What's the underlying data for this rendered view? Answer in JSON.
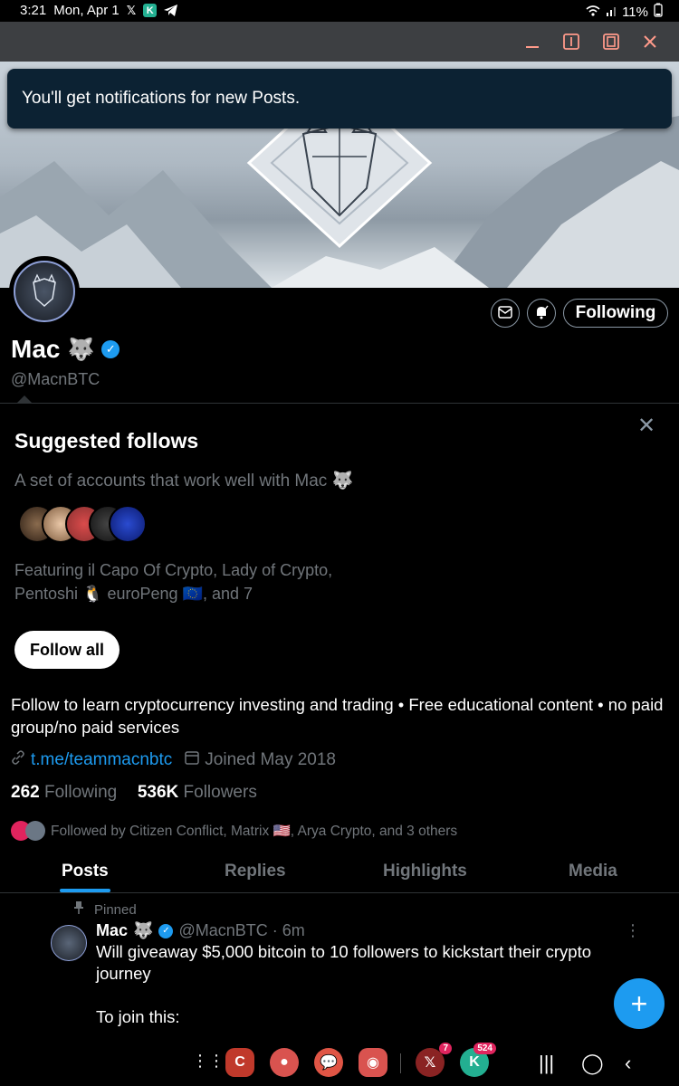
{
  "status_bar": {
    "time": "3:21",
    "date": "Mon, Apr 1",
    "battery": "11%"
  },
  "toast": {
    "text": "You'll get notifications for new Posts."
  },
  "profile": {
    "name": "Mac",
    "name_emoji": "🐺",
    "handle": "@MacnBTC",
    "following_button": "Following",
    "bio": "Follow to learn cryptocurrency investing and trading • Free educational content • no paid group/no paid services",
    "link": "t.me/teammacnbtc",
    "joined": "Joined May 2018",
    "following_count": "262",
    "following_label": "Following",
    "followers_count": "536K",
    "followers_label": "Followers",
    "followed_by": "Followed by Citizen Conflict, Matrix 🇺🇸, Arya Crypto, and 3 others"
  },
  "suggested": {
    "title": "Suggested follows",
    "subtitle": "A set of accounts that work well with Mac 🐺",
    "featuring": "Featuring il Capo Of Crypto, Lady of Crypto, Pentoshi 🐧 euroPeng 🇪🇺, and 7",
    "follow_all": "Follow all"
  },
  "tabs": [
    "Posts",
    "Replies",
    "Highlights",
    "Media"
  ],
  "post": {
    "pinned_label": "Pinned",
    "author": "Mac",
    "author_emoji": "🐺",
    "handle_time": "@MacnBTC · 6m",
    "text": "Will giveaway $5,000 bitcoin to 10 followers to kickstart their crypto journey\n\nTo join this:"
  },
  "nav": {
    "x_badge": "7",
    "k_badge": "524"
  },
  "colors": {
    "accent": "#1d9bf0",
    "background": "#000000",
    "muted": "#71767b",
    "toast": "#0c2233"
  }
}
